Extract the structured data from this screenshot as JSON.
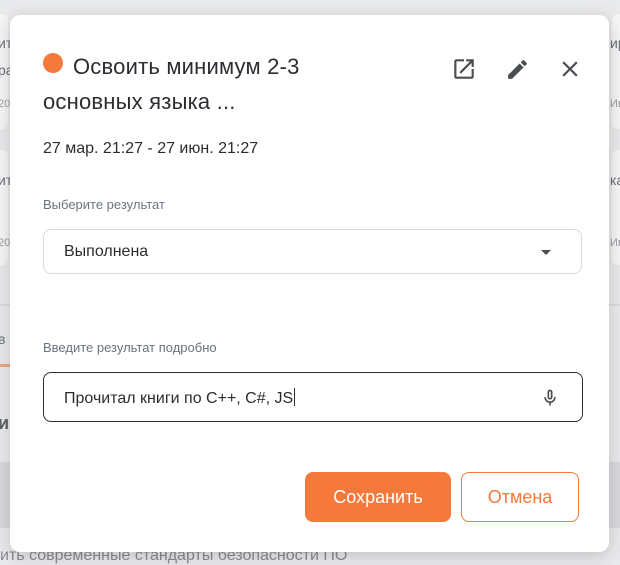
{
  "modal": {
    "title": "Освоить минимум 2-3 основных языка ...",
    "status_color": "#f5793b",
    "dates": "27 мар. 21:27 - 27 июн. 21:27",
    "result_label": "Выберите результат",
    "result_value": "Выполнена",
    "detail_label": "Введите результат подробно",
    "detail_value": "Прочитал книги по С++, C#, JS",
    "save_label": "Сохранить",
    "cancel_label": "Отмена",
    "icons": [
      "external-link-icon",
      "pencil-icon",
      "close-icon",
      "microphone-icon"
    ]
  },
  "background": {
    "bottom_text": "ить современные стандарты безопасности ПО",
    "left_fragments": [
      "ит",
      "ра",
      "20",
      "ит",
      "20",
      "в",
      "и"
    ],
    "right_fragments": [
      "ир",
      "Ив",
      "ка",
      "Ив"
    ]
  }
}
